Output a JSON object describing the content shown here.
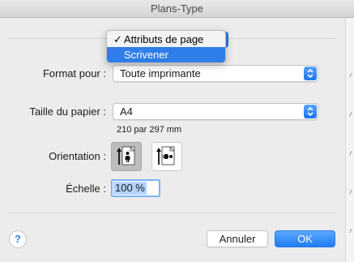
{
  "window": {
    "title": "Plans-Type"
  },
  "menu": {
    "items": [
      {
        "label": "Attributs de page",
        "check": "✓",
        "highlighted": false
      },
      {
        "label": "Scrivener",
        "check": "",
        "highlighted": true
      }
    ]
  },
  "form": {
    "format_label": "Format pour :",
    "format_value": "Toute imprimante",
    "paper_label": "Taille du papier :",
    "paper_value": "A4",
    "paper_dimensions": "210 par 297 mm",
    "orientation_label": "Orientation :",
    "scale_label": "Échelle :",
    "scale_value": "100 %"
  },
  "buttons": {
    "help_label": "?",
    "cancel_label": "Annuler",
    "ok_label": "OK"
  },
  "colors": {
    "accent": "#1f7cf3",
    "menu_highlight": "#2f7de8",
    "window_bg": "#ececec"
  },
  "icons": {
    "orientation_portrait": "portrait-person-icon",
    "orientation_landscape": "landscape-person-icon",
    "help": "question-mark-icon",
    "popup_arrows": "up-down-chevron-icon"
  }
}
